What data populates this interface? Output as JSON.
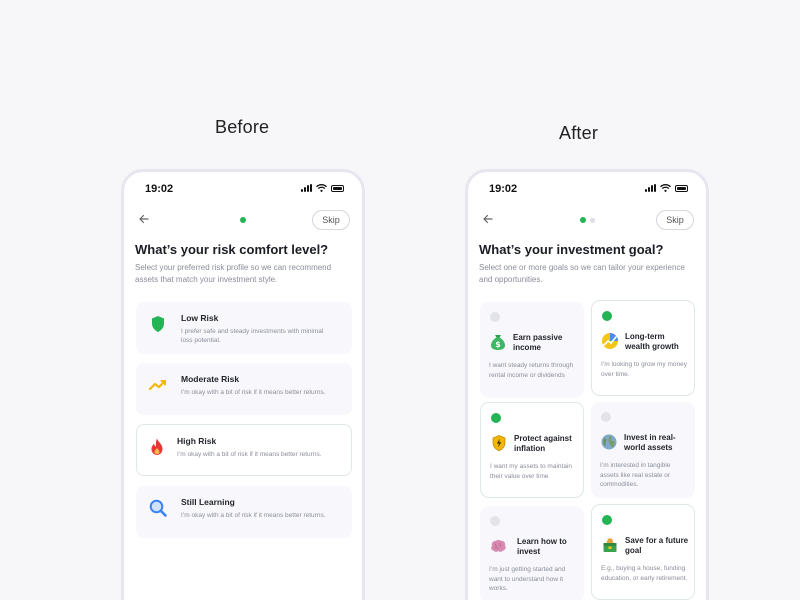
{
  "captions": {
    "before": "Before",
    "after": "After"
  },
  "status_time": "19:02",
  "skip_label": "Skip",
  "before_screen": {
    "title": "What’s your risk comfort level?",
    "subtitle": "Select your preferred risk profile so we can recommend assets that match your investment style.",
    "options": [
      {
        "label": "Low Risk",
        "desc": "I prefer safe and steady investments with minimal loss potential.",
        "icon": "shield-icon",
        "selected": false
      },
      {
        "label": "Moderate Risk",
        "desc": "I’m okay with a bit of risk if it means better returns.",
        "icon": "trend-icon",
        "selected": false
      },
      {
        "label": "High Risk",
        "desc": "I’m okay with a bit of risk if it means better returns.",
        "icon": "fire-icon",
        "selected": true
      },
      {
        "label": "Still Learning",
        "desc": "I’m okay with a bit of risk if it means better returns.",
        "icon": "magnifier-icon",
        "selected": false
      }
    ]
  },
  "after_screen": {
    "title": "What’s your investment goal?",
    "subtitle": "Select one or more goals so we can tailor your experience and opportunities.",
    "goals": [
      {
        "label": "Earn passive income",
        "desc": "I want steady returns through rental income or dividends",
        "icon": "money-bag-icon",
        "selected": false
      },
      {
        "label": "Long-term wealth growth",
        "desc": "I’m looking to grow my money over time.",
        "icon": "growth-chart-icon",
        "selected": true
      },
      {
        "label": "Protect against inflation",
        "desc": "I want my assets to maintain their value over time",
        "icon": "shield-bolt-icon",
        "selected": true
      },
      {
        "label": "Invest in real-world assets",
        "desc": "I’m interested in tangible assets like real estate or commodities.",
        "icon": "globe-icon",
        "selected": false
      },
      {
        "label": "Learn how to invest",
        "desc": "I’m just getting started and want to understand how it works.",
        "icon": "brain-icon",
        "selected": false
      },
      {
        "label": "Save for a future goal",
        "desc": "E.g., buying a house, funding education, or early retirement.",
        "icon": "savings-box-icon",
        "selected": true
      }
    ]
  },
  "colors": {
    "accent_green": "#22b455",
    "card_bg": "#f8f8fc",
    "page_bg": "#f7f7fa"
  }
}
